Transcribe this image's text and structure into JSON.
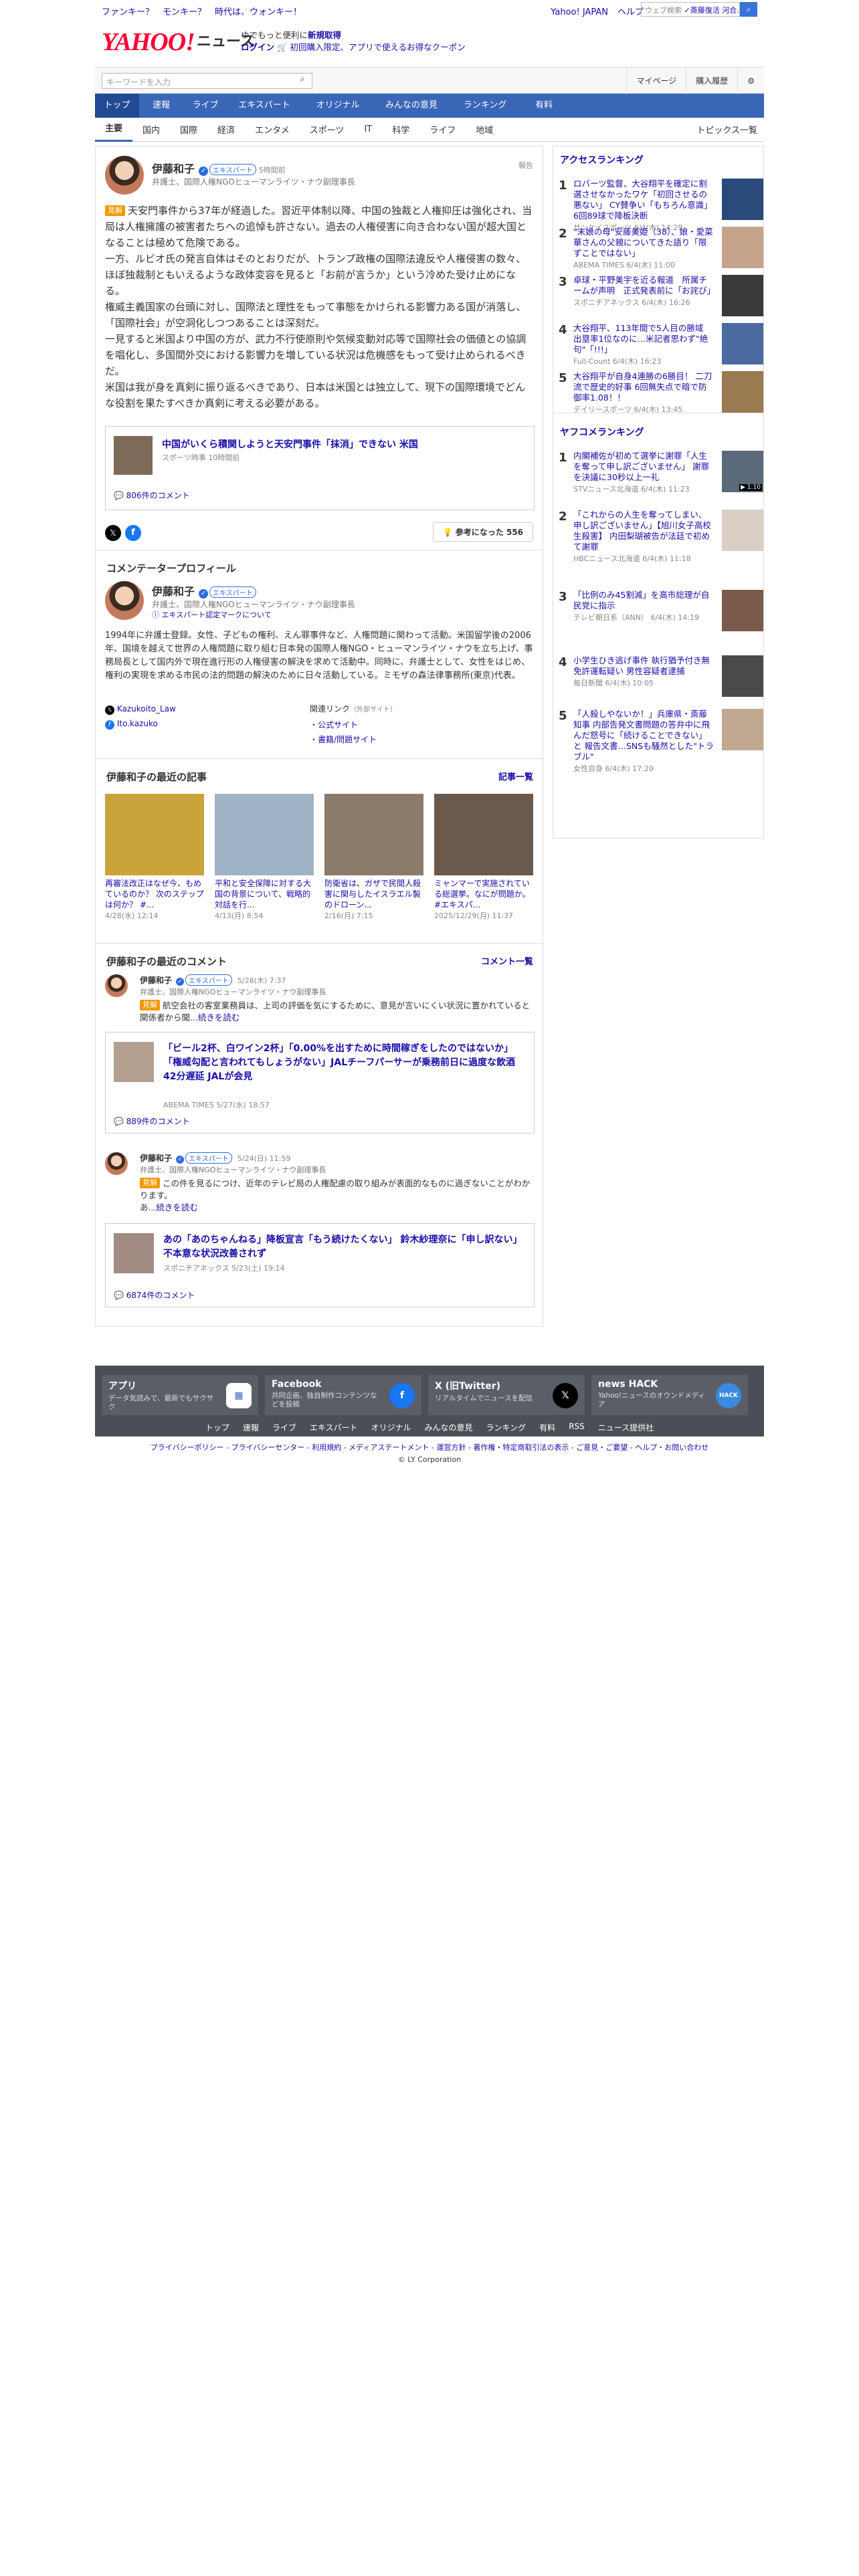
{
  "topstrip": {
    "promo": "ファンキー？　モンキー？　時代は、ウォンキー！",
    "yahoo": "Yahoo! JAPAN",
    "help": "ヘルプ",
    "web_search_placeholder": "ウェブ検索",
    "web_search_suggest": "✓斎藤復活 河合..."
  },
  "header": {
    "logo": "YAHOO!",
    "logo_sub": "JAPAN",
    "news": "ニュース",
    "msg1": "ゆでもっと便利に",
    "msg1b": "新規取得",
    "msg2": "ログイン",
    "msg3": "🛒 初回購入限定、アプリで使えるお得なクーポン"
  },
  "search": {
    "placeholder": "キーワードを入力",
    "mypage": "マイページ",
    "history": "購入履歴"
  },
  "nav": [
    "トップ",
    "速報",
    "ライブ",
    "エキスパート",
    "オリジナル",
    "みんなの意見",
    "ランキング",
    "有料"
  ],
  "subnav": [
    "主要",
    "国内",
    "国際",
    "経済",
    "エンタメ",
    "スポーツ",
    "IT",
    "科学",
    "ライフ",
    "地域"
  ],
  "subnav_right": "トピックス一覧",
  "comment": {
    "author": "伊藤和子",
    "expert": "エキスパート",
    "ago": "5時間前",
    "role": "弁護士、国際人権NGOヒューマンライツ・ナウ副理事長",
    "report": "報告",
    "tag": "見解",
    "text": "天安門事件から37年が経過した。習近平体制以降、中国の独裁と人権抑圧は強化され、当局は人権擁護の被害者たちへの追悼も許さない。過去の人権侵害に向き合わない国が超大国となることは極めて危険である。\n一方、ルビオ氏の発言自体はそのとおりだが、トランプ政権の国際法違反や人権侵害の数々、ほぼ独裁制ともいえるような政体変容を見ると「お前が言うか」という冷めた受け止めになる。\n権威主義国家の台頭に対し、国際法と理性をもって事態をかけられる影響力ある国が消落し、「国際社会」が空洞化しつつあることは深刻だ。\n一見すると米国より中国の方が、武力不行使原則や気候変動対応等で国際社会の価値との協調を唱化し、多国間外交における影響力を増している状況は危機感をもって受け止められるべきだ。\n米国は我が身を真剣に振り返るべきであり、日本は米国とは独立して、現下の国際環境でどんな役割を果たすべきか真剣に考える必要がある。"
  },
  "linked": {
    "title": "中国がいくら積関しようと天安門事件「抹消」できない 米国",
    "source": "スポーツ時事 10時間前",
    "comments": "806件のコメント"
  },
  "actions": {
    "helpful": "参考になった 556"
  },
  "profile": {
    "heading": "コメンテータープロフィール",
    "name": "伊藤和子",
    "badge": "エキスパート",
    "role": "弁護士、国際人権NGOヒューマンライツ・ナウ副理事長",
    "mark": "エキスパート認定マークについて",
    "bio": "1994年に弁護士登録。女性、子どもの権利、えん罪事件など、人権問題に関わって活動。米国留学後の2006年、国境を越えて世界の人権問題に取り組む日本発の国際人権NGO・ヒューマンライツ・ナウを立ち上げ、事務局長として国内外で現在進行形の人権侵害の解決を求めて活動中。同時に、弁護士として、女性をはじめ、権利の実現を求める市民の法的問題の解決のために日々活動している。ミモザの森法律事務所(東京)代表。",
    "x": "Kazukoito_Law",
    "fb": "Ito.kazuko",
    "related": "関連リンク",
    "related_ext": "（外部サイト）",
    "link1": "公式サイト",
    "link2": "書籍/問題サイト"
  },
  "recent_articles": {
    "heading": "伊藤和子の最近の記事",
    "more": "記事一覧",
    "items": [
      {
        "title": "再審法改正はなぜ今、もめているのか？ 次のステップは何か？ #...",
        "date": "4/28(水) 12:14"
      },
      {
        "title": "平和と安全保障に対する大国の背景について、戦略的対話を行...",
        "date": "4/13(月) 8:54"
      },
      {
        "title": "防衛省は、ガザで民間人殺害に関与したイスラエル製のドローン...",
        "date": "2/16(月) 7:15"
      },
      {
        "title": "ミャンマーで実施されている総選挙。なにが問題か。 #エキスパ...",
        "date": "2025/12/29(月) 11:37"
      }
    ]
  },
  "recent_comments": {
    "heading": "伊藤和子の最近のコメント",
    "more": "コメント一覧",
    "items": [
      {
        "name": "伊藤和子",
        "badge": "エキスパート",
        "date": "5/28(木) 7:37",
        "role": "弁護士、国際人権NGOヒューマンライツ・ナウ副理事長",
        "tag": "見解",
        "text": "航空会社の客室業務員は、上司の評価を気にするために、意見が言いにくい状況に置かれていると関係者から聞...",
        "more": "続きを読む",
        "article": "「ビール2杯、白ワイン2杯」「0.00%を出すために時間稼ぎをしたのではないか」「権威勾配と言われてもしょうがない」JALチーフパーサーが乗務前日に過度な飲酒 42分遅延 JALが会見",
        "source": "ABEMA TIMES 5/27(水) 18:57",
        "comments": "889件のコメント"
      },
      {
        "name": "伊藤和子",
        "badge": "エキスパート",
        "date": "5/24(日) 11:59",
        "role": "弁護士、国際人権NGOヒューマンライツ・ナウ副理事長",
        "tag": "見解",
        "text": "この件を見るにつけ、近年のテレビ局の人権配慮の取り組みが表面的なものに過ぎないことがわかります。\nあ...",
        "more": "続きを読む",
        "article": "あの「あのちゃんねる」降板宣言「もう続けたくない」 鈴木紗理奈に「申し訳ない」不本意な状況改善されず",
        "source": "スポニチアネックス 5/23(土) 19:14",
        "comments": "6874件のコメント"
      }
    ]
  },
  "access_ranking": {
    "heading": "アクセスランキング",
    "items": [
      {
        "title": "ロバーツ監督、大谷翔平を確定に割選させなかったワケ「初回させるの悪ない」 CY賛争い「もちろん意識」6回89球で降板決断",
        "src": "サンケイスポーツ 6/4(木) 14:29"
      },
      {
        "title": "\"末娘の母\"安藤美姫（38）、娘・愛菜華さんの父親についてきた語り「限ずことではない」",
        "src": "ABEMA TIMES 6/4(木) 11:00"
      },
      {
        "title": "卓球・平野美宇を近る報道　所属チームが声明　正式発表前に「お詫び」",
        "src": "スポニチアネックス 6/4(木) 16:26"
      },
      {
        "title": "大谷翔平、113年間で5人目の勝域　出塁率1位なのに…米記者思わず\"絶句\"「!!!」",
        "src": "Full-Count 6/4(木) 16:23"
      },
      {
        "title": "大谷翔平が自身4連勝の6勝目！ 二刀流で歴史的好事 6回無失点で暗で防御率1.08！！",
        "src": "デイリースポーツ 6/4(木) 13:45"
      }
    ]
  },
  "yahoo_comment_ranking": {
    "heading": "ヤフコメランキング",
    "items": [
      {
        "title": "内閣補佐が初めて選挙に謝罪「人生を奪って申し訳ございません」 謝罪を決議に30秒以上一礼",
        "src": "STVニュース北海道 6/4(木) 11:23",
        "badge": "▶ 1:10"
      },
      {
        "title": "「これからの人生を奪ってしまい、申し訳ございません」【旭川女子高校生殺害】 内田梨瑚被告が法廷で初めて謝罪",
        "src": "HBCニュース北海道 6/4(木) 11:18"
      },
      {
        "title": "「比例のみ45割減」を高市総理が自民党に指示",
        "src": "テレビ朝日系（ANN） 6/4(木) 14:19"
      },
      {
        "title": "小学生ひき逃げ事件 執行猶予付き無免許運転疑い 男性容疑者逮捕",
        "src": "毎日新聞 6/4(木) 10:05"
      },
      {
        "title": "「人殺しやないか！」兵庫県・斎藤知事 内部告発文書問題の答弁中に飛んだ怒号に「続けることできない」と 報告文書…SNSも騒然とした\"トラブル\"",
        "src": "女性自身 6/4(木) 17:20"
      }
    ]
  },
  "footer": {
    "apps": [
      {
        "name": "アプリ",
        "desc": "データ気読みで、最新でもサクサク"
      },
      {
        "name": "Facebook",
        "desc": "共同企画、独自制作コンテンツなどを投稿"
      },
      {
        "name": "X (旧Twitter)",
        "desc": "リアルタイムでニュースを配信"
      },
      {
        "name": "news HACK",
        "desc": "Yahoo!ニュースのオウンドメディア"
      }
    ],
    "links": [
      "トップ",
      "速報",
      "ライブ",
      "エキスパート",
      "オリジナル",
      "みんなの意見",
      "ランキング",
      "有料",
      "RSS",
      "ニュース提供社"
    ],
    "legal": "プライバシーポリシー - プライバシーセンター - 利用規約 - メディアステートメント - 運営方針 - 著作権・特定商取引法の表示 - ご意見・ご要望 - ヘルプ・お問い合わせ",
    "copyright": "© LY Corporation"
  }
}
